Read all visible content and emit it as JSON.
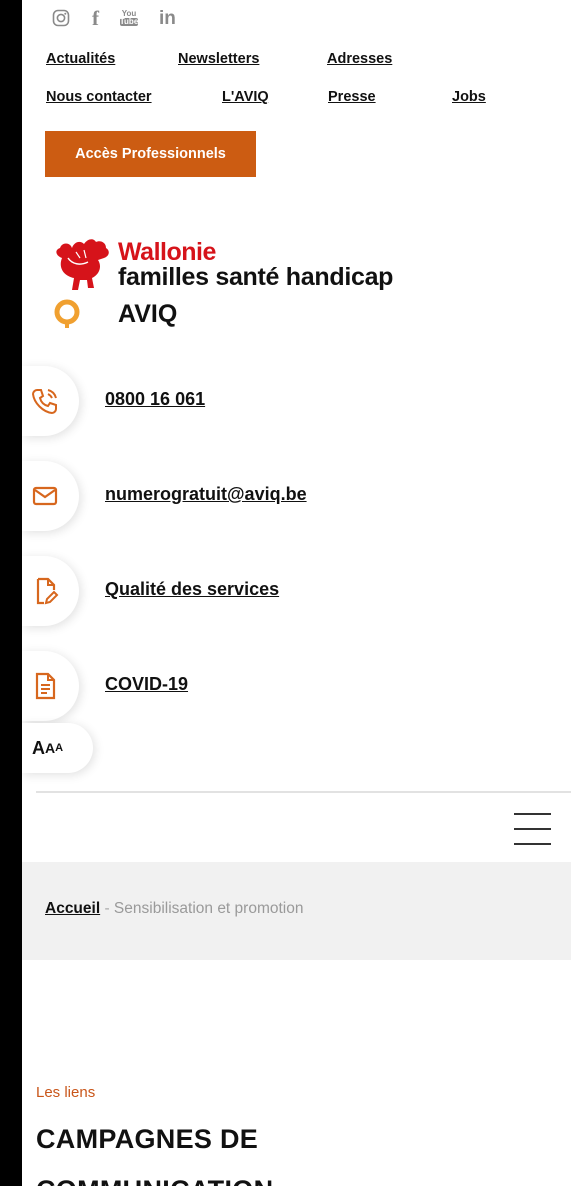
{
  "social": {
    "icons": [
      "instagram-icon",
      "facebook-icon",
      "youtube-icon",
      "linkedin-icon"
    ],
    "youtube_top": "You",
    "youtube_bottom": "Tube",
    "facebook_glyph": "f",
    "linkedin_glyph": "in"
  },
  "top_nav": {
    "row1": [
      "Actualités",
      "Newsletters",
      "Adresses"
    ],
    "row2": [
      "Nous contacter",
      "L'AVIQ",
      "Presse",
      "Jobs"
    ]
  },
  "pro_button": "Accès Professionnels",
  "logo": {
    "line1": "Wallonie",
    "line2": "familles santé handicap",
    "line3": "AVIQ"
  },
  "contacts": [
    {
      "icon": "phone-icon",
      "label": "0800 16 061"
    },
    {
      "icon": "mail-icon",
      "label": "numerogratuit@aviq.be"
    },
    {
      "icon": "document-edit-icon",
      "label": "Qualité des services"
    },
    {
      "icon": "document-list-icon",
      "label": "COVID-19"
    }
  ],
  "text_size": {
    "big": "A",
    "mid": "A",
    "small": "A"
  },
  "breadcrumb": {
    "home": "Accueil",
    "separator": " - ",
    "current": "Sensibilisation et promotion"
  },
  "section": {
    "eyebrow": "Les liens",
    "title_line1": "CAMPAGNES DE",
    "title_line2": "COMMUNICATION"
  },
  "colors": {
    "accent": "#cc5c12",
    "brand_red": "#d6131a",
    "icon_orange": "#d7671e"
  }
}
